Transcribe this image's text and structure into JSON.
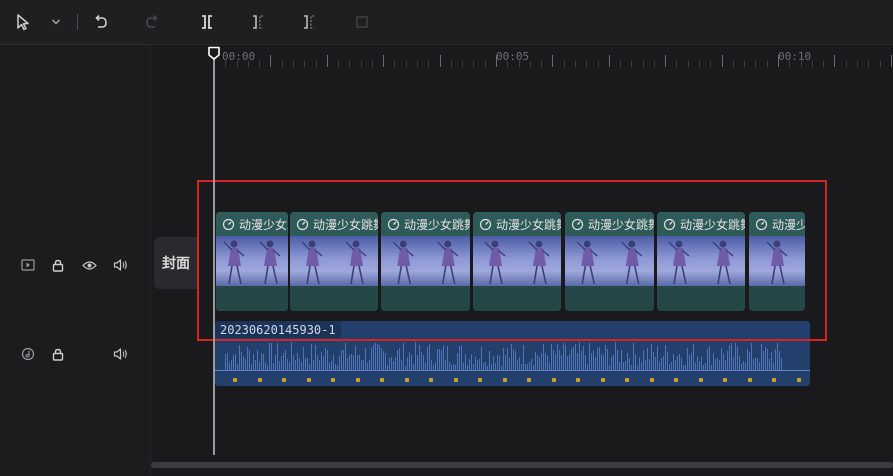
{
  "toolbar": {
    "tools": [
      "select-tool",
      "select-menu",
      "undo",
      "redo",
      "split",
      "trim-left",
      "trim-right",
      "delete"
    ]
  },
  "ruler": {
    "labels": [
      "00:00",
      "00:05",
      "00:10"
    ]
  },
  "tracks": {
    "video": {
      "cover_label": "封面"
    },
    "audio": {
      "clip_name": "20230620145930-1"
    }
  },
  "video_clips": [
    {
      "title": "动漫少女跳舞"
    },
    {
      "title": "动漫少女跳舞"
    },
    {
      "title": "动漫少女跳舞"
    },
    {
      "title": "动漫少女跳舞"
    },
    {
      "title": "动漫少女跳舞"
    },
    {
      "title": "动漫少女跳舞"
    },
    {
      "title": "动漫少女跳舞"
    }
  ],
  "colors": {
    "selection_border": "#d42424",
    "video_clip": "#2e5b59",
    "audio_clip": "#23406d",
    "keyframe": "#c9a227"
  }
}
